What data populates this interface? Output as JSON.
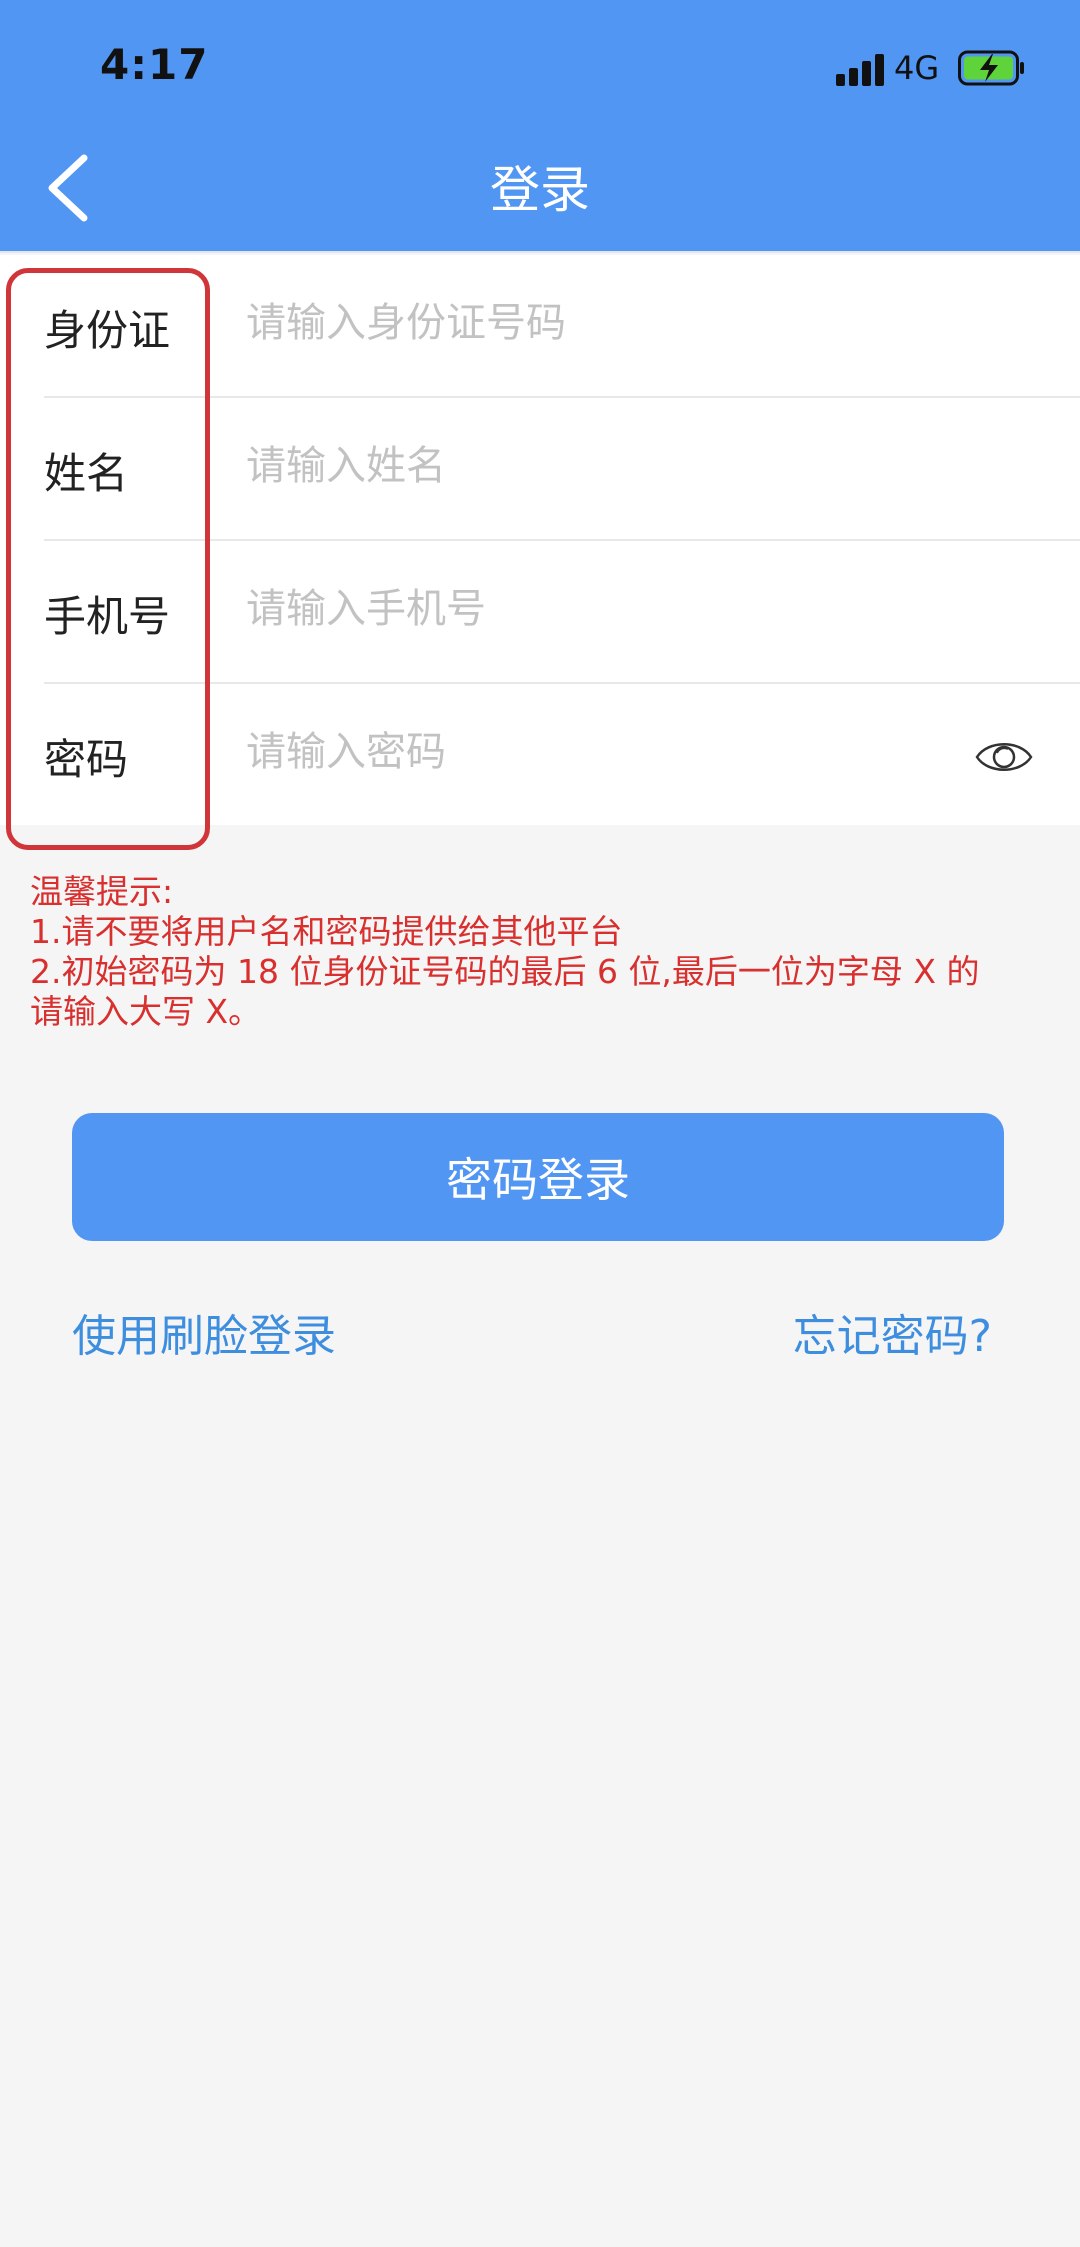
{
  "status_bar": {
    "time": "4:17",
    "network": "4G",
    "icons": [
      "signal-icon",
      "battery-charging-icon"
    ]
  },
  "nav": {
    "back_icon": "chevron-left-icon",
    "title": "登录"
  },
  "form": {
    "rows": [
      {
        "label": "身份证",
        "placeholder": "请输入身份证号码",
        "value": ""
      },
      {
        "label": "姓名",
        "placeholder": "请输入姓名",
        "value": ""
      },
      {
        "label": "手机号",
        "placeholder": "请输入手机号",
        "value": ""
      },
      {
        "label": "密码",
        "placeholder": "请输入密码",
        "value": ""
      }
    ],
    "password_toggle_icon": "eye-icon"
  },
  "tips": {
    "title": "温馨提示:",
    "line1": "1.请不要将用户名和密码提供给其他平台",
    "line2": "2.初始密码为 18 位身份证号码的最后 6 位,最后一位为字母 X 的",
    "line3": "请输入大写 X。"
  },
  "actions": {
    "login_button": "密码登录",
    "face_login": "使用刷脸登录",
    "forgot_password": "忘记密码?"
  },
  "colors": {
    "primary": "#5196f2",
    "tip_text": "#d8302e",
    "link": "#3e8ee0",
    "highlight_border": "#d0353a",
    "background": "#f5f5f5"
  }
}
